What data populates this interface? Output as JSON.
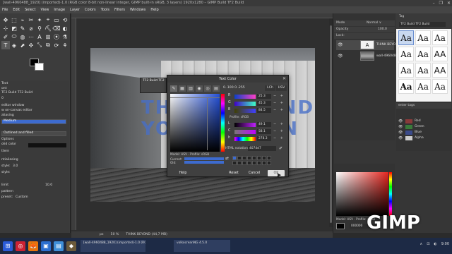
{
  "window": {
    "title": "[wall-4960488_1920] (imported)-1.0 (RGB color 8-bit non-linear integer, GIMP built-in sRGB, 3 layers) 1920x1280 – GIMP Build TF2 Build",
    "controls": [
      "–",
      "❐",
      "✕"
    ]
  },
  "menu": [
    "File",
    "Edit",
    "Select",
    "View",
    "Image",
    "Layer",
    "Colors",
    "Tools",
    "Filters",
    "Windows",
    "Help"
  ],
  "toolbox": {
    "tools": [
      "✥",
      "⬚",
      "⌁",
      "✂",
      "✦",
      "⌖",
      "▭",
      "⟲",
      "⊹",
      "◩",
      "✎",
      "⌀",
      "⚲",
      "⛏",
      "⌫",
      "◐",
      "✐",
      "⬭",
      "◍",
      "⋯",
      "A",
      "⊞",
      "⦿",
      "⚗",
      "T",
      "◈",
      "⬈",
      "✣",
      "⤡",
      "⧉",
      "⟳",
      "⚘"
    ],
    "fg_color": "#000000",
    "bg_color": "#ffffff"
  },
  "tool_options": {
    "header": "Text",
    "font_label": "ont",
    "font_value": "TF2 Build TF2 Build",
    "size_value": "0",
    "editor_label": "editor window",
    "oncanvas_label": "w on-canvas editor",
    "aliasing_label": "aliasing",
    "hinting_value": "Medium",
    "outline_value": "Outlined and filled",
    "options_label": "Options",
    "color_label": "olid color",
    "pattern_label": "ttern",
    "antialias_label": "ntialiasing",
    "style_label": "style:",
    "style_value": "3.0",
    "style2_label": "style:",
    "limit_label": "limit",
    "limit_value": "10.0",
    "pattern2_label": "pattern",
    "custom_label": "Custom",
    "preset_label": "preset:"
  },
  "canvas": {
    "image_text_line1": "THINK BEYOND",
    "image_text_line2": "YOUR DESIGN",
    "text_toolbar_label": "TF2 Build TF2"
  },
  "statusbar": {
    "unit": "px",
    "zoom": "50 %",
    "layer_info": "THINK BEYOND (44,7 MB)"
  },
  "dialog": {
    "title": "Text Color",
    "close": "✕",
    "tabs": [
      "✎",
      "▦",
      "▥",
      "◉",
      "◎",
      "▤"
    ],
    "scale_label": "0..100   0..255",
    "lch": "LCh",
    "hsv": "HSV",
    "channels": [
      {
        "name": "R",
        "value": "25.3"
      },
      {
        "name": "G",
        "value": "45.3"
      },
      {
        "name": "B",
        "value": "84.5"
      },
      {
        "name": "L",
        "value": "49.1"
      },
      {
        "name": "C",
        "value": "58.1"
      },
      {
        "name": "h",
        "value": "278.3"
      }
    ],
    "profile_label": "Profile: sRGB",
    "model_label": "Model: HSV - Profile: sRGB",
    "current_label": "Current:",
    "old_label": "Old:",
    "html_label": "HTML notation:",
    "html_value": "4074d7",
    "picker_icon": "✐",
    "history_arrow": "⇄",
    "help": "Help",
    "reset": "Reset",
    "cancel": "Cancel",
    "ok": "OK",
    "current_color": "#3d6bcf"
  },
  "layers": {
    "mode_label": "Mode",
    "mode_value": "Normal ∨",
    "opacity_label": "Opacity",
    "opacity_value": "100.0",
    "lock_label": "Lock:",
    "items": [
      {
        "name": "THINK BEYO",
        "thumb": "#f2f2f2"
      },
      {
        "name": "wall-496048",
        "thumb": "#888888"
      }
    ]
  },
  "fonts": {
    "tag_label": "Tag",
    "font_name": "TF2 Build TF2 Build",
    "samples": [
      "Aa",
      "Aa",
      "Aa",
      "Aa",
      "Aa",
      "AA",
      "Aa",
      "Aa",
      "AA",
      "Aa",
      "Aa",
      "Aa"
    ]
  },
  "channels_panel": {
    "header": "enter tags",
    "items": [
      {
        "name": "Red",
        "color": "#8a3a3a"
      },
      {
        "name": "Green",
        "color": "#3a7a3a"
      },
      {
        "name": "Blue",
        "color": "#3a4a8a"
      },
      {
        "name": "Alpha",
        "color": "#cccccc"
      }
    ]
  },
  "colors_panel": {
    "profile": "Model: HSV - Profile: sRGB",
    "hex": "000000"
  },
  "overlay_label": "GIMP",
  "taskbar": {
    "icons": [
      "⊞",
      "◎",
      "🦊",
      "▣",
      "▤",
      "◆"
    ],
    "tasks": [
      "[wall-4960488_1920] (imported)-1.0 (RGB color 8-bit non-linear integer, GI...",
      "volkocreanNG 4.5.0"
    ],
    "tray": [
      "∧",
      "⊡",
      "◐",
      "9:00"
    ]
  }
}
